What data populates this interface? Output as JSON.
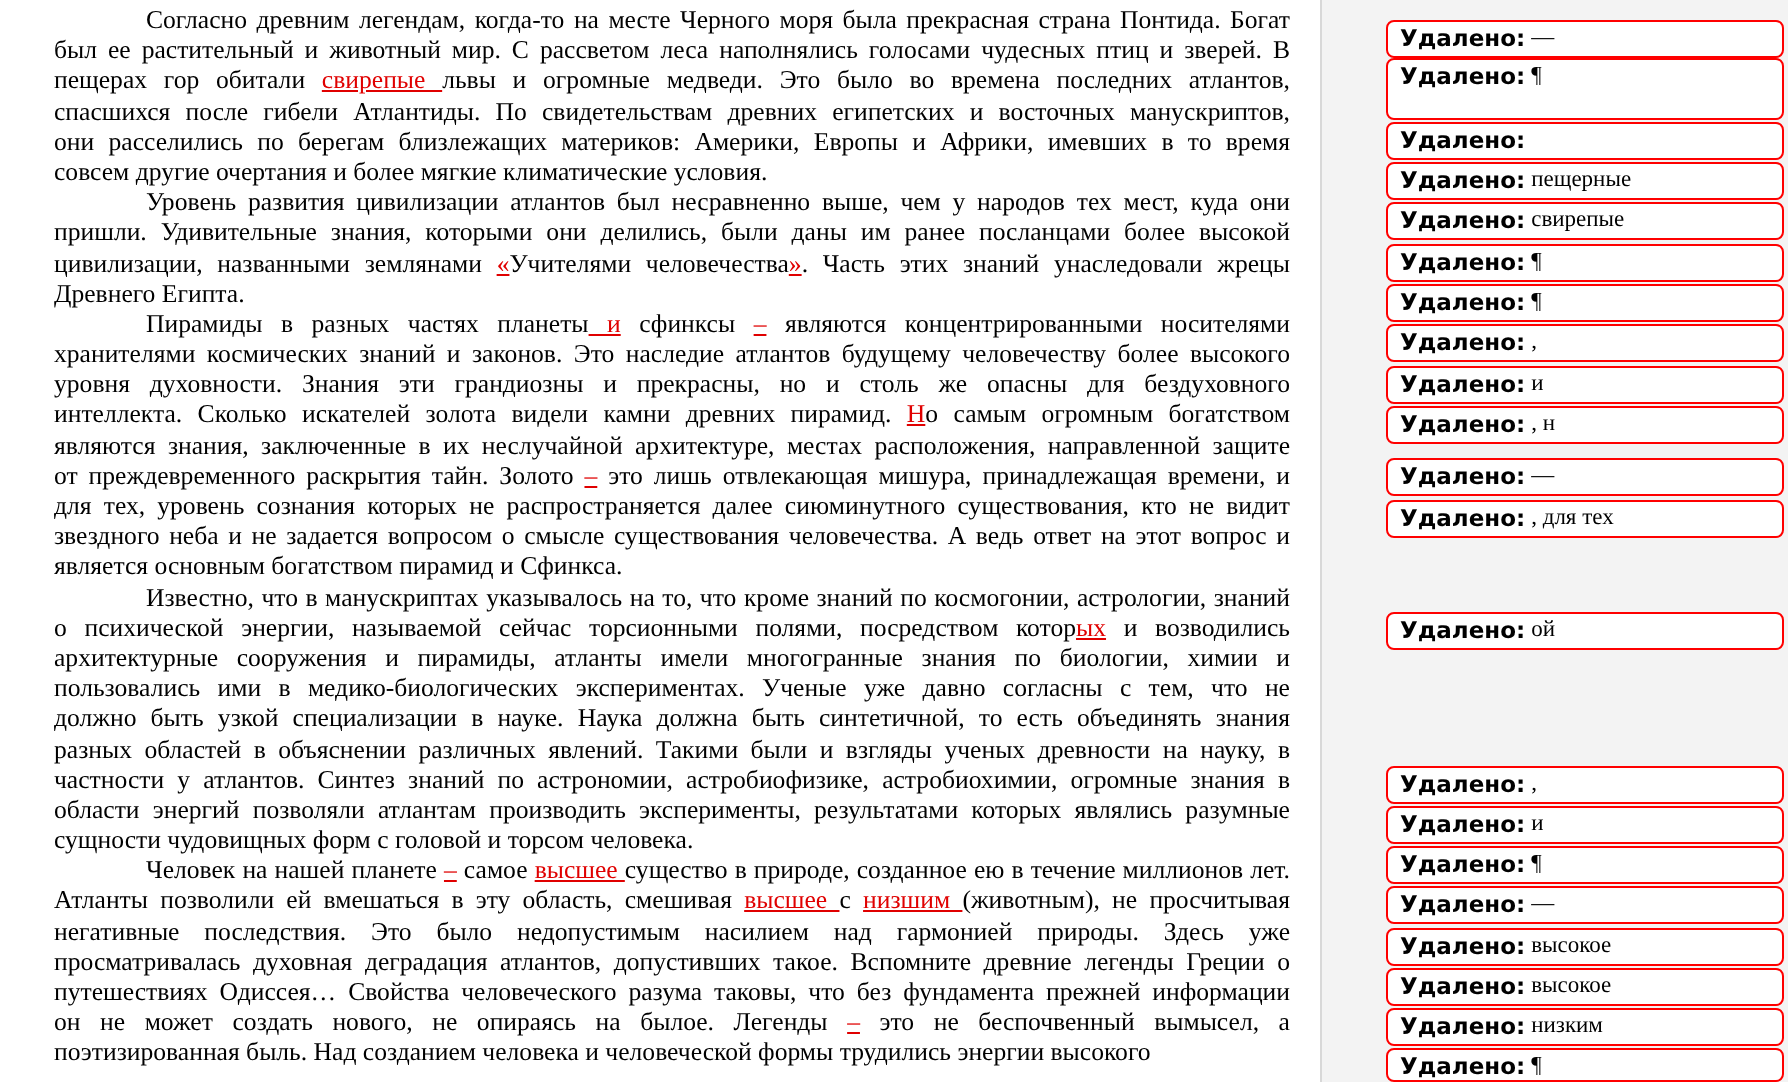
{
  "paragraphs": [
    {
      "lines": [
        [
          "Согласно древним легендам, когда-то на месте Черного моря была прекрасная страна Понтида. Богат"
        ],
        [
          "был ее растительный и животный мир. С рассветом леса наполнялись голосами чудесных птиц и зверей. В"
        ],
        [
          "пещерах гор обитали ",
          {
            "kind": "insert",
            "text": "свирепые "
          },
          "львы и огромные медведи. Это было во времена последних атлантов,"
        ],
        [
          "спасшихся после гибели Атлантиды. По свидетельствам древних египетских и восточных манускриптов,"
        ],
        [
          "они расселились по берегам близлежащих материков: Америки, Европы и Африки, имевших в то время"
        ],
        [
          "совсем другие очертания и более мягкие климатические условия."
        ]
      ]
    },
    {
      "lines": [
        [
          "Уровень развития цивилизации атлантов был несравненно выше, чем у народов тех мест, куда они"
        ],
        [
          "пришли. Удивительные знания, которыми они делились, были даны им ранее посланцами более высокой"
        ],
        [
          "цивилизации, названными землянами ",
          {
            "kind": "insert",
            "text": "«"
          },
          "Учителями человечества",
          {
            "kind": "insert",
            "text": "»"
          },
          ". Часть этих знаний унаследовали жрецы"
        ],
        [
          "Древнего Египта."
        ]
      ]
    },
    {
      "lines": [
        [
          "Пирамиды в разных частях планеты",
          {
            "kind": "insert",
            "text": " и"
          },
          " сфинксы ",
          {
            "kind": "insert",
            "text": "–"
          },
          " являются концентрированными носителями"
        ],
        [
          "хранителями космических знаний и законов. Это наследие атлантов будущему человечеству более высокого"
        ],
        [
          "уровня духовности. Знания эти грандиозны и прекрасны, но и столь же опасны для бездуховного"
        ],
        [
          "интеллекта. Сколько искателей золота видели камни древних пирамид. ",
          {
            "kind": "insert",
            "text": "Н"
          },
          "о самым огромным богатством"
        ],
        [
          "являются знания, заключенные в их неслучайной архитектуре, местах расположения, направленной защите"
        ],
        [
          "от преждевременного раскрытия тайн. Золото ",
          {
            "kind": "insert",
            "text": "–"
          },
          " это лишь отвлекающая мишура, принадлежащая времени, и"
        ],
        [
          "для тех, уровень сознания которых не распространяется далее сиюминутного существования, кто не видит"
        ],
        [
          "звездного неба и не задается вопросом о смысле существования человечества. А ведь ответ на этот вопрос и"
        ],
        [
          "является основным богатством пирамид и Сфинкса."
        ]
      ]
    },
    {
      "lines": [
        [
          "Известно, что в манускриптах указывалось на то, что кроме знаний по космогонии, астрологии, знаний"
        ],
        [
          "о психической энергии, называемой сейчас торсионными полями, посредством котор",
          {
            "kind": "insert",
            "text": "ых"
          },
          " и возводились"
        ],
        [
          "архитектурные сооружения и пирамиды, атланты имели многогранные знания по биологии, химии и"
        ],
        [
          "пользовались ими в медико-биологических экспериментах. Ученые уже давно согласны с тем, что не"
        ],
        [
          "должно быть узкой специализации в науке. Наука должна быть синтетичной, то есть объединять знания"
        ],
        [
          "разных областей в объяснении различных явлений. Такими были и взгляды ученых древности на науку, в"
        ],
        [
          "частности у атлантов. Синтез знаний по астрономии, астробиофизике, астробиохимии, огромные знания в"
        ],
        [
          "области энергий позволяли атлантам производить эксперименты, результатами которых являлись разумные"
        ],
        [
          "сущности чудовищных форм с головой и торсом человека."
        ]
      ]
    },
    {
      "lines": [
        [
          "Человек на нашей планете ",
          {
            "kind": "insert",
            "text": "–"
          },
          " самое ",
          {
            "kind": "insert",
            "text": "высшее "
          },
          "существо в природе, созданное ею в течение миллионов лет."
        ],
        [
          "Атланты позволили ей вмешаться в эту область, смешивая ",
          {
            "kind": "insert",
            "text": "высшее "
          },
          "с ",
          {
            "kind": "insert",
            "text": "низшим "
          },
          "(животным), не просчитывая"
        ],
        [
          "негативные последствия. Это было недопустимым насилием над гармонией природы. Здесь уже"
        ],
        [
          "просматривалась духовная деградация атлантов, допустивших такое. Вспомните древние легенды Греции о"
        ],
        [
          "путешествиях Одиссея… Свойства человеческого разума таковы, что без фундамента прежней информации"
        ],
        [
          "он не может создать нового, не опираясь на былое. Легенды ",
          {
            "kind": "insert",
            "text": "–"
          },
          " это не беспочвенный вымысел, а"
        ],
        [
          "поэтизированная быль. Над созданием человека и человеческой формы трудились энергии высокого"
        ]
      ]
    }
  ],
  "balloons": [
    {
      "label": "Удалено:",
      "text": "—"
    },
    {
      "label": "Удалено:",
      "text": "¶"
    },
    {
      "label": "Удалено:"
    },
    {
      "label": "Удалено:",
      "text": "пещерные"
    },
    {
      "label": "Удалено:",
      "text": "свирепые"
    },
    {
      "label": "Удалено:",
      "text": "¶"
    },
    {
      "label": "Удалено:",
      "text": "¶"
    },
    {
      "label": "Удалено:",
      "text": ","
    },
    {
      "label": "Удалено:",
      "text": "и"
    },
    {
      "label": "Удалено:",
      "text": ", н"
    },
    {
      "label": "Удалено:",
      "text": "—"
    },
    {
      "label": "Удалено:",
      "text": ", для тех"
    },
    {
      "label": "Удалено:",
      "text": "ой"
    },
    {
      "label": "Удалено:",
      "text": ","
    },
    {
      "label": "Удалено:",
      "text": "и"
    },
    {
      "label": "Удалено:",
      "text": "¶"
    },
    {
      "label": "Удалено:",
      "text": "—"
    },
    {
      "label": "Удалено:",
      "text": "высокое"
    },
    {
      "label": "Удалено:",
      "text": "высокое"
    },
    {
      "label": "Удалено:",
      "text": "низким"
    },
    {
      "label": "Удалено:",
      "text": "¶"
    }
  ]
}
